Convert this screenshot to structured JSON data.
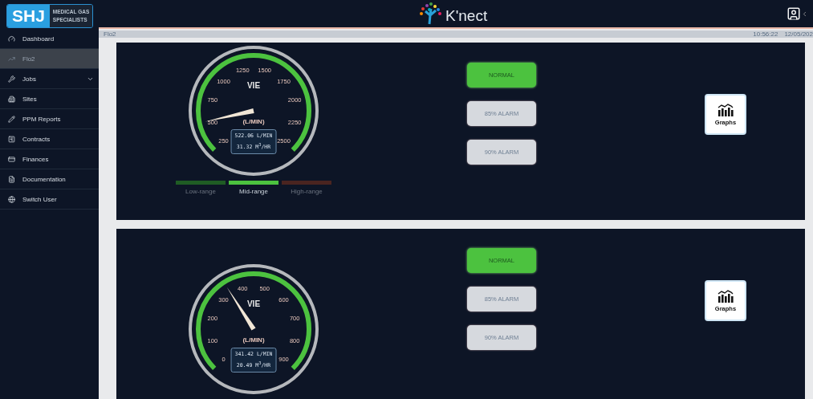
{
  "header": {
    "logo": {
      "mark": "SHJ",
      "tagline_1": "MEDICAL GAS",
      "tagline_2": "SPECIALISTS"
    },
    "brand": "K'nect"
  },
  "sidebar": {
    "items": [
      {
        "label": "Dashboard",
        "selected": false,
        "has_submenu": false
      },
      {
        "label": "Flo2",
        "selected": true,
        "has_submenu": false
      },
      {
        "label": "Jobs",
        "selected": false,
        "has_submenu": true
      },
      {
        "label": "Sites",
        "selected": false,
        "has_submenu": false
      },
      {
        "label": "PPM Reports",
        "selected": false,
        "has_submenu": false
      },
      {
        "label": "Contracts",
        "selected": false,
        "has_submenu": false
      },
      {
        "label": "Finances",
        "selected": false,
        "has_submenu": false
      },
      {
        "label": "Documentation",
        "selected": false,
        "has_submenu": false
      },
      {
        "label": "Switch User",
        "selected": false,
        "has_submenu": false
      }
    ]
  },
  "breadcrumb": {
    "page": "Flo2",
    "time": "10:56:22",
    "date": "12/05/202"
  },
  "panels": [
    {
      "gauge": {
        "title": "VIE",
        "unit": "(L/MIN)",
        "scale": [
          "250",
          "500",
          "750",
          "1000",
          "1250",
          "1500",
          "1750",
          "2000",
          "2250",
          "2500"
        ],
        "readout_1": "522.06 L/MIN",
        "readout_2": "31.32 M$^{3}$/HR"
      },
      "ranges": [
        {
          "label": "Low-range",
          "selected": false,
          "color": "#1f5c24"
        },
        {
          "label": "Mid-range",
          "selected": true,
          "color": "#4cc23f"
        },
        {
          "label": "High-range",
          "selected": false,
          "color": "#4a2420"
        }
      ],
      "alarms": [
        {
          "label": "NORMAL",
          "active": true
        },
        {
          "label": "85% ALARM",
          "active": false
        },
        {
          "label": "90% ALARM",
          "active": false
        }
      ],
      "graphs_button": "Graphs"
    },
    {
      "gauge": {
        "title": "VIE",
        "unit": "(L/MIN)",
        "scale": [
          "0",
          "100",
          "200",
          "300",
          "400",
          "500",
          "600",
          "700",
          "800",
          "900"
        ],
        "readout_1": "341.42 L/MIN",
        "readout_2": "20.49 M$^{3}$/HR"
      },
      "alarms": [
        {
          "label": "NORMAL",
          "active": true
        },
        {
          "label": "85% ALARM",
          "active": false
        },
        {
          "label": "90% ALARM",
          "active": false
        }
      ],
      "graphs_button": "Graphs"
    }
  ]
}
